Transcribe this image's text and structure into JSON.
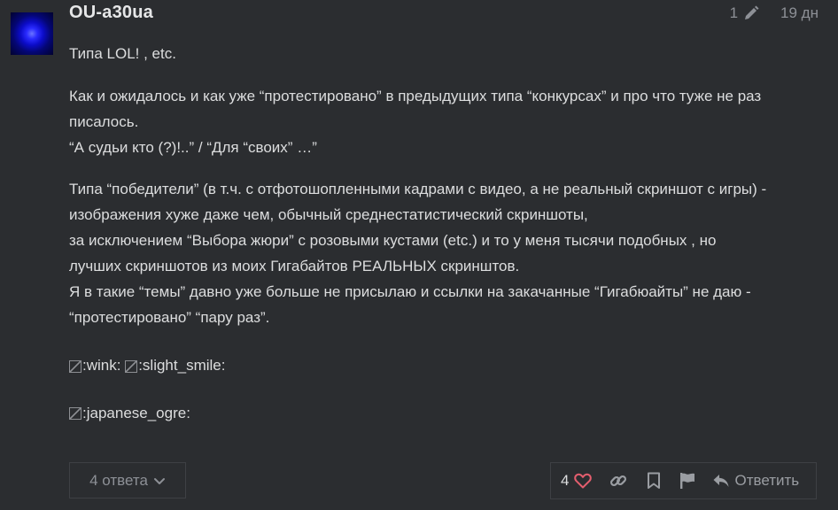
{
  "post": {
    "username": "OU-a30ua",
    "edit_count": "1",
    "time_ago": "19 дн",
    "paragraphs": {
      "p1": "Типа LOL! , etc.",
      "p2_lines": [
        "Как и ожидалось и как уже “протестировано” в предыдущих типа “конкурсах” и про что туже не раз",
        "писалось.",
        "“А судьи кто (?)!..” / “Для “своих” …”"
      ],
      "p3_lines": [
        "Типа “победители” (в т.ч. с отфотошопленными кадрами с видео, а не реальный скриншот с игры) -",
        "изображения хуже даже чем, обычный среднестатистический скриншоты,",
        "за исключением “Выбора жюри” с розовыми кустами (etc.) и то у меня тысячи подобных , но",
        "лучших скриншотов из моих Гигабайтов РЕАЛЬНЫХ скринштов.",
        "Я в такие “темы” давно уже больше не присылаю и ссылки на закачанные “Гигабюайты” не даю -",
        "“протестировано” “пару раз”."
      ]
    },
    "emojis": {
      "wink": ":wink:",
      "slight_smile": ":slight_smile:",
      "japanese_ogre": ":japanese_ogre:"
    },
    "replies_label": "4 ответа",
    "like_count": "4",
    "reply_label": "Ответить"
  },
  "colors": {
    "background": "#2b2d30",
    "heart": "#e45e6e",
    "muted": "#8d9096"
  },
  "icons": [
    "pencil-icon",
    "chevron-down-icon",
    "heart-icon",
    "link-icon",
    "bookmark-icon",
    "flag-icon",
    "reply-icon"
  ]
}
